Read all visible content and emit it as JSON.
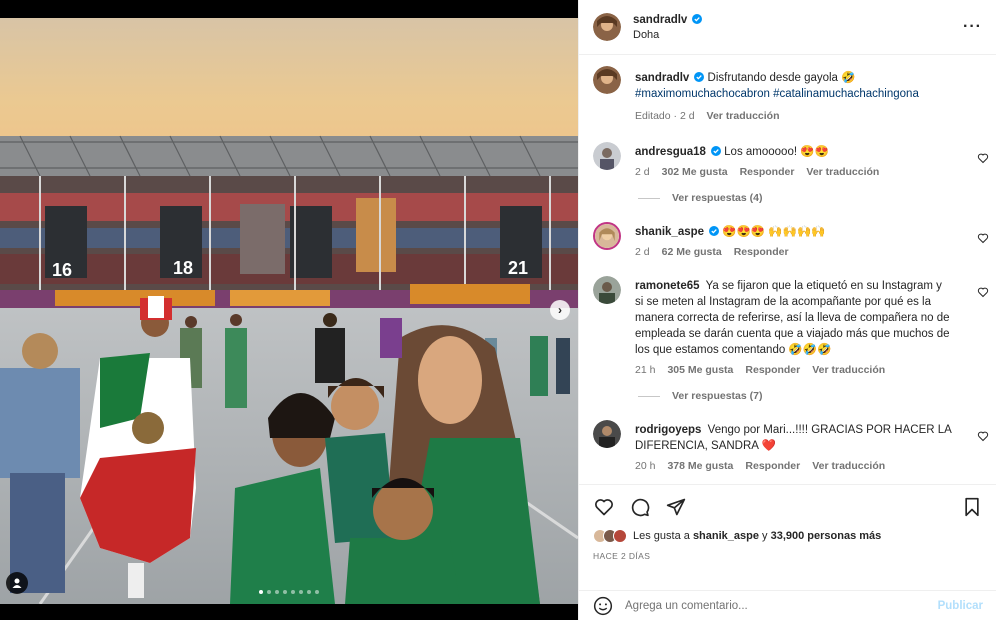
{
  "post": {
    "author": "sandradlv",
    "location": "Doha",
    "caption_text": "Disfrutando desde gayola 🤣",
    "hashtags": "#maximomuchachocabron #catalinamuchachachingona",
    "edited_label": "Editado · 2 d",
    "translate_label": "Ver traducción",
    "carousel_dots": 8,
    "carousel_active": 0
  },
  "photo_text": {
    "gate_16": "16",
    "gate_18": "18",
    "gate_21": "21"
  },
  "comments": [
    {
      "user": "andresgua18",
      "verified": true,
      "text": "Los amooooo! 😍😍",
      "time": "2 d",
      "likes": "302 Me gusta",
      "reply": "Responder",
      "translate": "Ver traducción",
      "replies": "Ver respuestas (4)"
    },
    {
      "user": "shanik_aspe",
      "verified": true,
      "text": "😍😍😍 🙌🙌🙌🙌",
      "time": "2 d",
      "likes": "62 Me gusta",
      "reply": "Responder"
    },
    {
      "user": "ramonete65",
      "verified": false,
      "text": "Ya se fijaron que la etiquetó en su Instagram y si se meten al Instagram de la acompañante por qué es la manera correcta de referirse, así la lleva de compañera no de empleada se darán cuenta que a viajado más que muchos de los que estamos comentando 🤣🤣🤣",
      "time": "21 h",
      "likes": "305 Me gusta",
      "reply": "Responder",
      "translate": "Ver traducción",
      "replies": "Ver respuestas (7)"
    },
    {
      "user": "rodrigoyeps",
      "verified": false,
      "text": "Vengo por Mari...!!!! GRACIAS POR HACER LA DIFERENCIA, SANDRA ❤️",
      "time": "20 h",
      "likes": "378 Me gusta",
      "reply": "Responder",
      "translate": "Ver traducción"
    }
  ],
  "likes": {
    "prefix": "Les gusta a",
    "first_user": "shanik_aspe",
    "connector": "y",
    "others": "33,900 personas más"
  },
  "timestamp": "HACE 2 DÍAS",
  "composer": {
    "placeholder": "Agrega un comentario...",
    "publish": "Publicar"
  },
  "colors": {
    "link": "#00376b",
    "secondary": "#737373",
    "publish_disabled": "#b2dffc",
    "verified": "#0095f6"
  },
  "icons": [
    "more-icon",
    "heart-icon",
    "comment-icon",
    "share-icon",
    "bookmark-icon",
    "emoji-icon",
    "verified-icon",
    "user-tag-icon",
    "chevron-right-icon"
  ]
}
